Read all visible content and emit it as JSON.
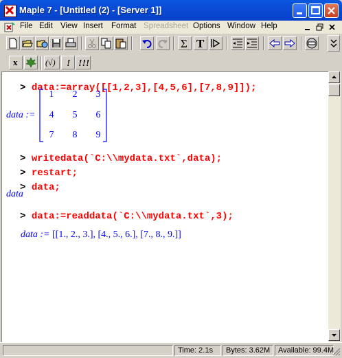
{
  "window": {
    "title": "Maple 7  - [Untitled (2) - [Server 1]]"
  },
  "menu": [
    "File",
    "Edit",
    "View",
    "Insert",
    "Format",
    "Spreadsheet",
    "Options",
    "Window",
    "Help"
  ],
  "menu_disabled": "Spreadsheet",
  "toolbar2": {
    "x_btn": "x",
    "paren_btn": "(√)",
    "bang_btn": "!",
    "triple_bang_btn": "!!!"
  },
  "toolbar1": {
    "sigma": "Σ",
    "text_T": "T"
  },
  "worksheet": {
    "prompt": ">",
    "cmd1": "data:=array([[1,2,3],[4,5,6],[7,8,9]]);",
    "out1_label": "data :=",
    "matrix": [
      [
        "1",
        "2",
        "3"
      ],
      [
        "4",
        "5",
        "6"
      ],
      [
        "7",
        "8",
        "9"
      ]
    ],
    "cmd2": "writedata(`C:\\\\mydata.txt`,data);",
    "cmd3": "restart;",
    "cmd4": "data;",
    "out4": "data",
    "cmd5": "data:=readdata(`C:\\\\mydata.txt`,3);",
    "out5_label": "data :=",
    "out5_value": "[[1., 2., 3.], [4., 5., 6.], [7., 8., 9.]]"
  },
  "status": {
    "time": "Time:   2.1s",
    "bytes": "Bytes: 3.62M",
    "available": "Available: 99.4M"
  },
  "colors": {
    "command": "#ff0000",
    "output": "#0000ff",
    "titlebar": "#0a4bd6"
  }
}
